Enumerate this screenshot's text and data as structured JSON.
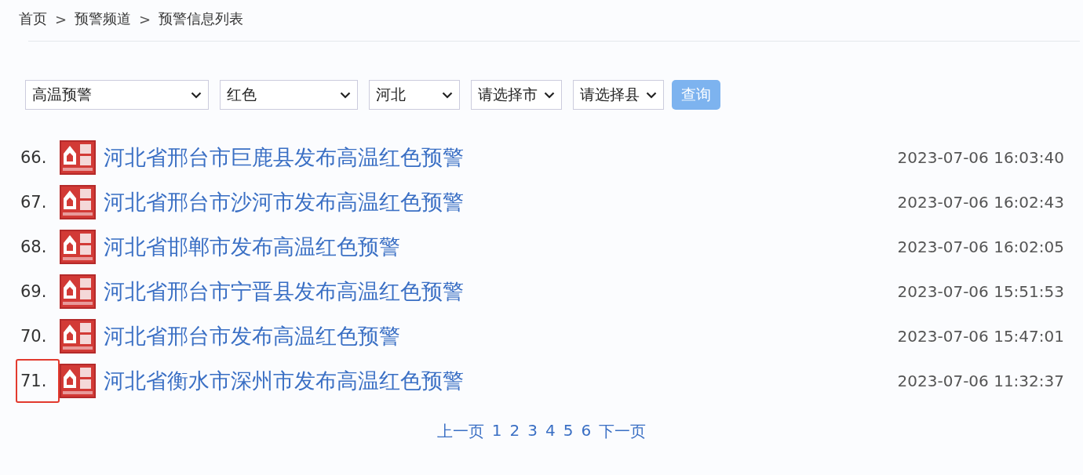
{
  "breadcrumb": [
    "首页",
    "预警频道",
    "预警信息列表"
  ],
  "breadcrumb_separator": ">",
  "filters": [
    {
      "value": "高温预警"
    },
    {
      "value": "红色"
    },
    {
      "value": "河北"
    },
    {
      "value": "请选择市"
    },
    {
      "value": "请选择县"
    }
  ],
  "query_button": "查询",
  "alerts": [
    {
      "number": "66.",
      "title": "河北省邢台市巨鹿县发布高温红色预警",
      "time": "2023-07-06 16:03:40",
      "highlighted": false
    },
    {
      "number": "67.",
      "title": "河北省邢台市沙河市发布高温红色预警",
      "time": "2023-07-06 16:02:43",
      "highlighted": false
    },
    {
      "number": "68.",
      "title": "河北省邯郸市发布高温红色预警",
      "time": "2023-07-06 16:02:05",
      "highlighted": false
    },
    {
      "number": "69.",
      "title": "河北省邢台市宁晋县发布高温红色预警",
      "time": "2023-07-06 15:51:53",
      "highlighted": false
    },
    {
      "number": "70.",
      "title": "河北省邢台市发布高温红色预警",
      "time": "2023-07-06 15:47:01",
      "highlighted": false
    },
    {
      "number": "71.",
      "title": "河北省衡水市深州市发布高温红色预警",
      "time": "2023-07-06 11:32:37",
      "highlighted": true
    }
  ],
  "pagination": {
    "previous": "上一页",
    "pages": [
      "1",
      "2",
      "3",
      "4",
      "5",
      "6"
    ],
    "next": "下一页"
  }
}
